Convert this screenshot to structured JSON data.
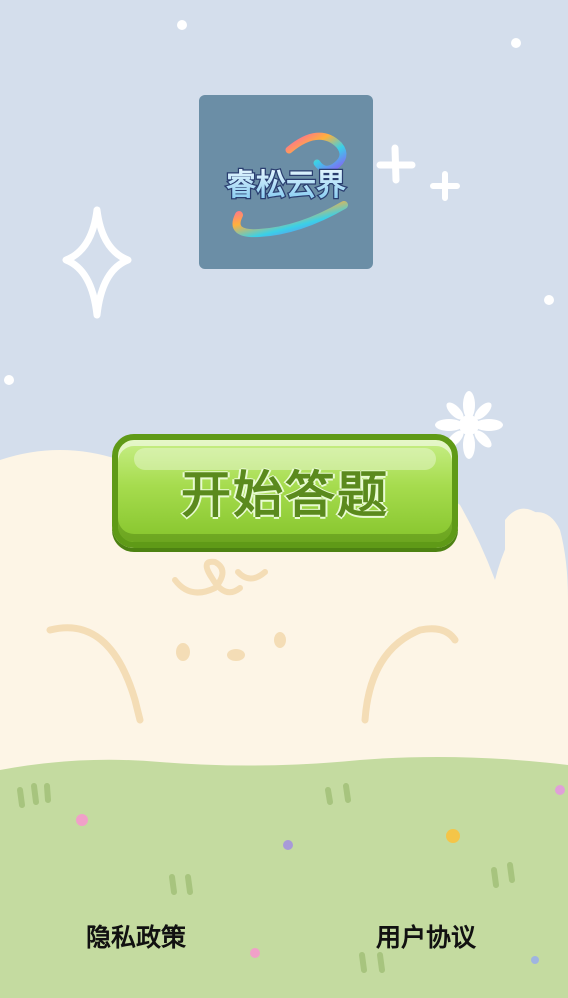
{
  "logo": {
    "text": "睿松云界",
    "background_color": "#6b8ea6"
  },
  "start_button": {
    "label": "开始答题",
    "color": "#a6dc4e"
  },
  "footer": {
    "privacy_label": "隐私政策",
    "terms_label": "用户协议"
  },
  "theme": {
    "sky_color": "#d4deec",
    "cream_color": "#fdf5e6",
    "grass_color": "#c4dba0"
  }
}
